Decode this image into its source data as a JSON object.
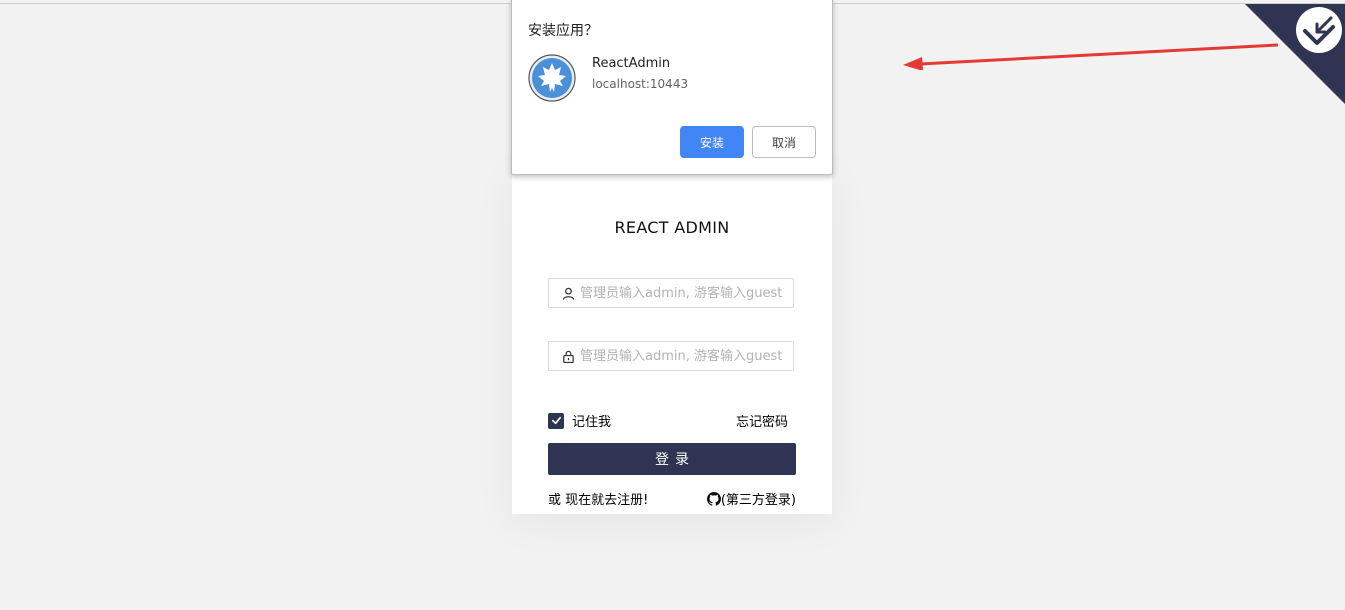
{
  "install_dialog": {
    "title": "安装应用？",
    "app_name": "ReactAdmin",
    "origin": "localhost:10443",
    "install_label": "安装",
    "cancel_label": "取消"
  },
  "login": {
    "title": "REACT ADMIN",
    "username_placeholder": "管理员输入admin, 游客输入guest",
    "password_placeholder": "管理员输入admin, 游客输入guest",
    "remember_label": "记住我",
    "remember_checked": true,
    "forgot_label": "忘记密码",
    "submit_label": "登录",
    "register_label": "或 现在就去注册!",
    "third_party_label": "(第三方登录)"
  },
  "colors": {
    "background": "#f2f2f2",
    "primary_dark": "#2f3452",
    "install_blue": "#4285f4",
    "arrow_red": "#e53935"
  }
}
